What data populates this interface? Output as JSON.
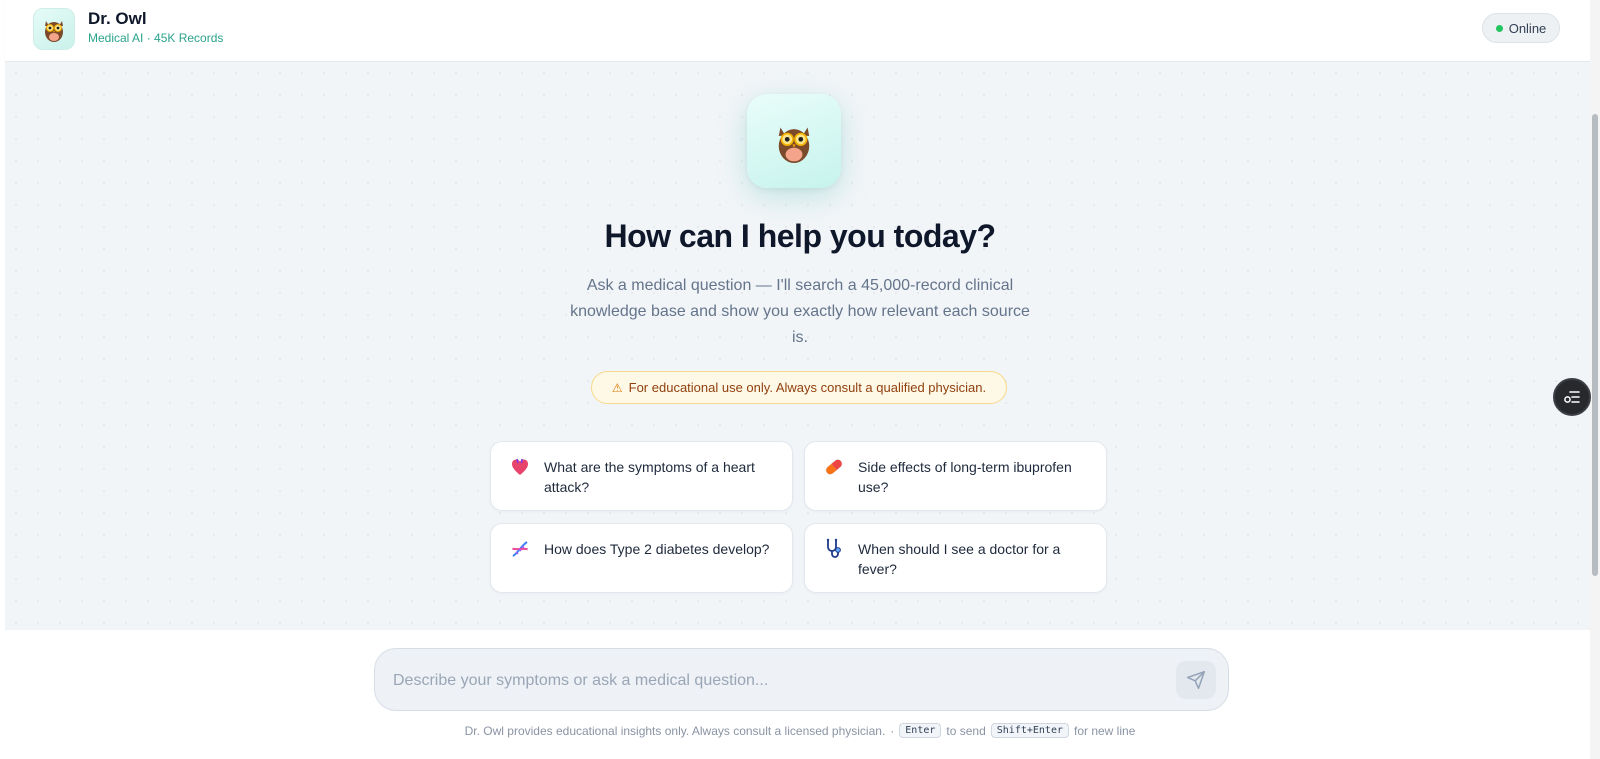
{
  "header": {
    "title": "Dr. Owl",
    "subtitle": "Medical AI · 45K Records",
    "status": "Online",
    "logo_icon": "owl-icon"
  },
  "hero": {
    "icon": "owl-icon",
    "title": "How can I help you today?",
    "description": "Ask a medical question — I'll search a 45,000-record clinical knowledge base and show you exactly how relevant each source is.",
    "disclaimer": "For educational use only. Always consult a qualified physician."
  },
  "suggestions": [
    {
      "icon": "anatomical-heart-icon",
      "text": "What are the symptoms of a heart attack?"
    },
    {
      "icon": "pill-icon",
      "text": "Side effects of long-term ibuprofen use?"
    },
    {
      "icon": "dna-icon",
      "text": "How does Type 2 diabetes develop?"
    },
    {
      "icon": "stethoscope-icon",
      "text": "When should I see a doctor for a fever?"
    }
  ],
  "composer": {
    "placeholder": "Describe your symptoms or ask a medical question...",
    "value": "",
    "send_icon": "send-icon"
  },
  "footer": {
    "note": "Dr. Owl provides educational insights only. Always consult a licensed physician.",
    "separator": "·",
    "key_send": "Enter",
    "send_text": "to send",
    "key_newline": "Shift+Enter",
    "newline_text": "for new line"
  },
  "colors": {
    "accent": "#2aa38c",
    "status_online": "#22c55e",
    "warning_bg": "#fef9e7",
    "warning_text": "#92400e"
  }
}
